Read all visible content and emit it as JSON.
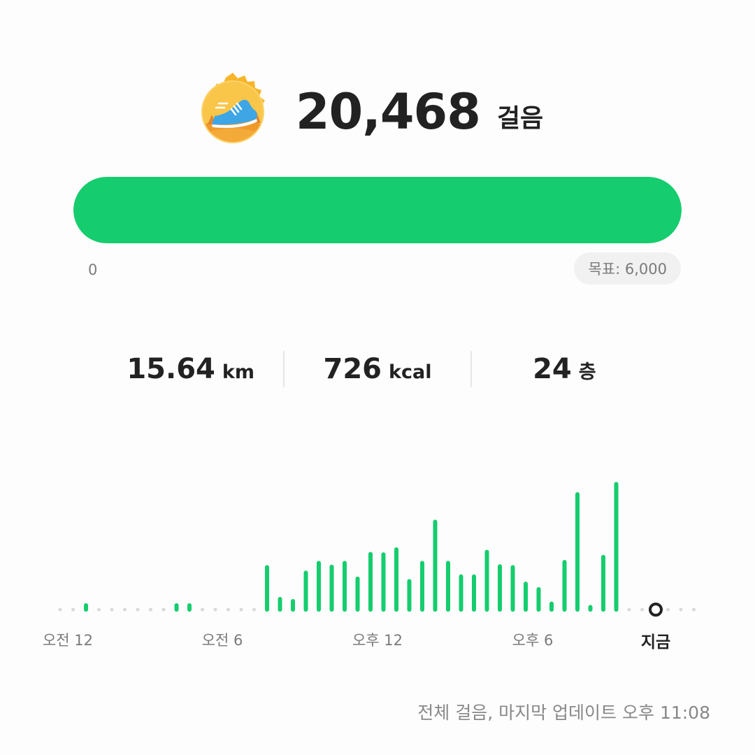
{
  "header": {
    "badge_icon": "sneaker-badge-icon",
    "steps_value": "20,468",
    "steps_unit": "걸음"
  },
  "progress": {
    "fraction": 1.0,
    "min_label": "0",
    "goal_label": "목표: 6,000",
    "color": "#15cd6e"
  },
  "stats": {
    "distance": {
      "value": "15.64",
      "unit": "km"
    },
    "calories": {
      "value": "726",
      "unit": "kcal"
    },
    "floors": {
      "value": "24",
      "unit": "층"
    }
  },
  "chart_data": {
    "type": "bar",
    "x_labels": [
      "오전 12",
      "오전 6",
      "오후 12",
      "오후 6",
      "지금"
    ],
    "values": [
      0,
      0,
      1,
      0,
      0,
      0,
      0,
      0,
      0,
      1,
      1,
      0,
      0,
      0,
      0,
      0,
      10,
      2.5,
      2,
      8.7,
      11,
      10.1,
      11,
      7.3,
      13.1,
      13,
      14.2,
      6.7,
      11,
      20.7,
      11,
      7.8,
      7.8,
      13.6,
      10.2,
      10,
      6.1,
      4.8,
      1.4,
      11.2,
      27.2,
      0.6,
      12.4,
      29.6
    ],
    "ylim": [
      0,
      30
    ],
    "bar_color": "#15cd6e",
    "dot_color": "#d9d9d9"
  },
  "footer": {
    "text": "전체 걸음, 마지막 업데이트 오후 11:08"
  }
}
